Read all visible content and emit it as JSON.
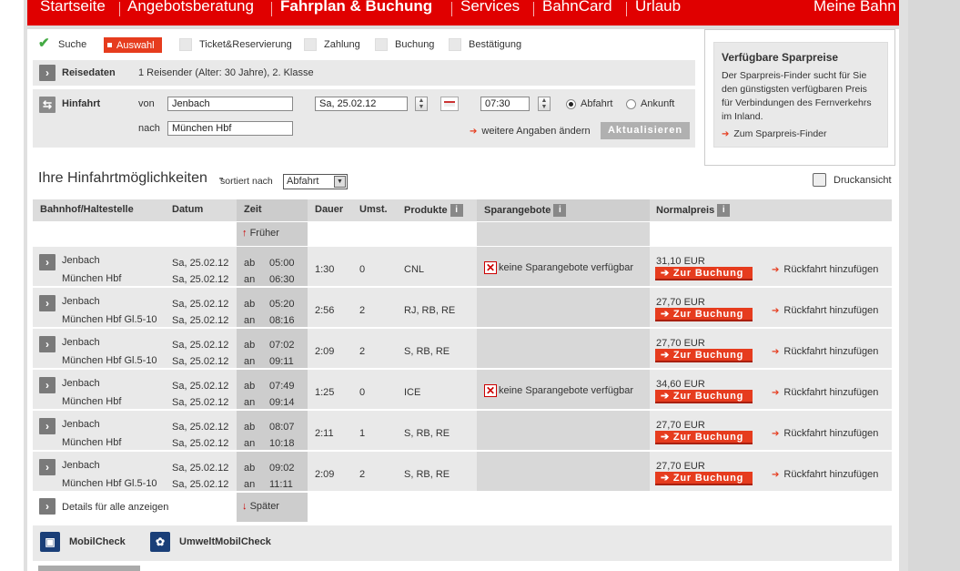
{
  "nav": {
    "items": [
      "Startseite",
      "Angebotsberatung",
      "Fahrplan & Buchung",
      "Services",
      "BahnCard",
      "Urlaub"
    ],
    "right": "Meine Bahn"
  },
  "steps": [
    "Suche",
    "Auswahl",
    "Ticket&Reservierung",
    "Zahlung",
    "Buchung",
    "Bestätigung"
  ],
  "reisedaten": {
    "title": "Reisedaten",
    "value": "1 Reisender (Alter: 30 Jahre), 2. Klasse"
  },
  "hinfahrt": {
    "title": "Hinfahrt",
    "von_label": "von",
    "von_value": "Jenbach",
    "nach_label": "nach",
    "nach_value": "München Hbf",
    "date": "Sa, 25.02.12",
    "time": "07:30",
    "abfahrt": "Abfahrt",
    "ankunft": "Ankunft",
    "more_link": "weitere Angaben ändern",
    "update_btn": "Aktualisieren"
  },
  "sparpreise": {
    "title": "Verfügbare Sparpreise",
    "text": "Der Sparpreis-Finder sucht für Sie den günstigsten verfügbaren Preis für Verbindungen des Fernverkehrs im Inland.",
    "link": "Zum Sparpreis-Finder"
  },
  "list": {
    "heading": "Ihre Hinfahrtmöglichkeiten",
    "dash": "-",
    "sort_label": "sortiert nach",
    "sort_value": "Abfahrt",
    "print": "Druckansicht",
    "earlier": "Früher",
    "later": "Später",
    "details_all": "Details für alle anzeigen"
  },
  "columns": [
    "Bahnhof/Haltestelle",
    "Datum",
    "Zeit",
    "Dauer",
    "Umst.",
    "Produkte",
    "Sparangebote",
    "Normalpreis"
  ],
  "labels": {
    "ab": "ab",
    "an": "an",
    "book": "Zur Buchung",
    "return": "Rückfahrt hinzufügen"
  },
  "rows": [
    {
      "from": "Jenbach",
      "to": "München Hbf",
      "date_dep": "Sa, 25.02.12",
      "date_arr": "Sa, 25.02.12",
      "dep": "05:00",
      "arr": "06:30",
      "duration": "1:30",
      "changes": "0",
      "products": "CNL",
      "spar": "keine Sparangebote verfügbar",
      "price": "31,10 EUR"
    },
    {
      "from": "Jenbach",
      "to": "München Hbf Gl.5-10",
      "date_dep": "Sa, 25.02.12",
      "date_arr": "Sa, 25.02.12",
      "dep": "05:20",
      "arr": "08:16",
      "duration": "2:56",
      "changes": "2",
      "products": "RJ, RB, RE",
      "spar": "",
      "price": "27,70 EUR"
    },
    {
      "from": "Jenbach",
      "to": "München Hbf Gl.5-10",
      "date_dep": "Sa, 25.02.12",
      "date_arr": "Sa, 25.02.12",
      "dep": "07:02",
      "arr": "09:11",
      "duration": "2:09",
      "changes": "2",
      "products": "S, RB, RE",
      "spar": "",
      "price": "27,70 EUR"
    },
    {
      "from": "Jenbach",
      "to": "München Hbf",
      "date_dep": "Sa, 25.02.12",
      "date_arr": "Sa, 25.02.12",
      "dep": "07:49",
      "arr": "09:14",
      "duration": "1:25",
      "changes": "0",
      "products": "ICE",
      "spar": "keine Sparangebote verfügbar",
      "price": "34,60 EUR"
    },
    {
      "from": "Jenbach",
      "to": "München Hbf",
      "date_dep": "Sa, 25.02.12",
      "date_arr": "Sa, 25.02.12",
      "dep": "08:07",
      "arr": "10:18",
      "duration": "2:11",
      "changes": "1",
      "products": "S, RB, RE",
      "spar": "",
      "price": "27,70 EUR"
    },
    {
      "from": "Jenbach",
      "to": "München Hbf Gl.5-10",
      "date_dep": "Sa, 25.02.12",
      "date_arr": "Sa, 25.02.12",
      "dep": "09:02",
      "arr": "11:11",
      "duration": "2:09",
      "changes": "2",
      "products": "S, RB, RE",
      "spar": "",
      "price": "27,70 EUR"
    }
  ],
  "footer": {
    "mobil": "MobilCheck",
    "umwelt": "UmweltMobilCheck"
  },
  "colors": {
    "brand_red": "#e00000",
    "accent_orange": "#e63c1e"
  }
}
